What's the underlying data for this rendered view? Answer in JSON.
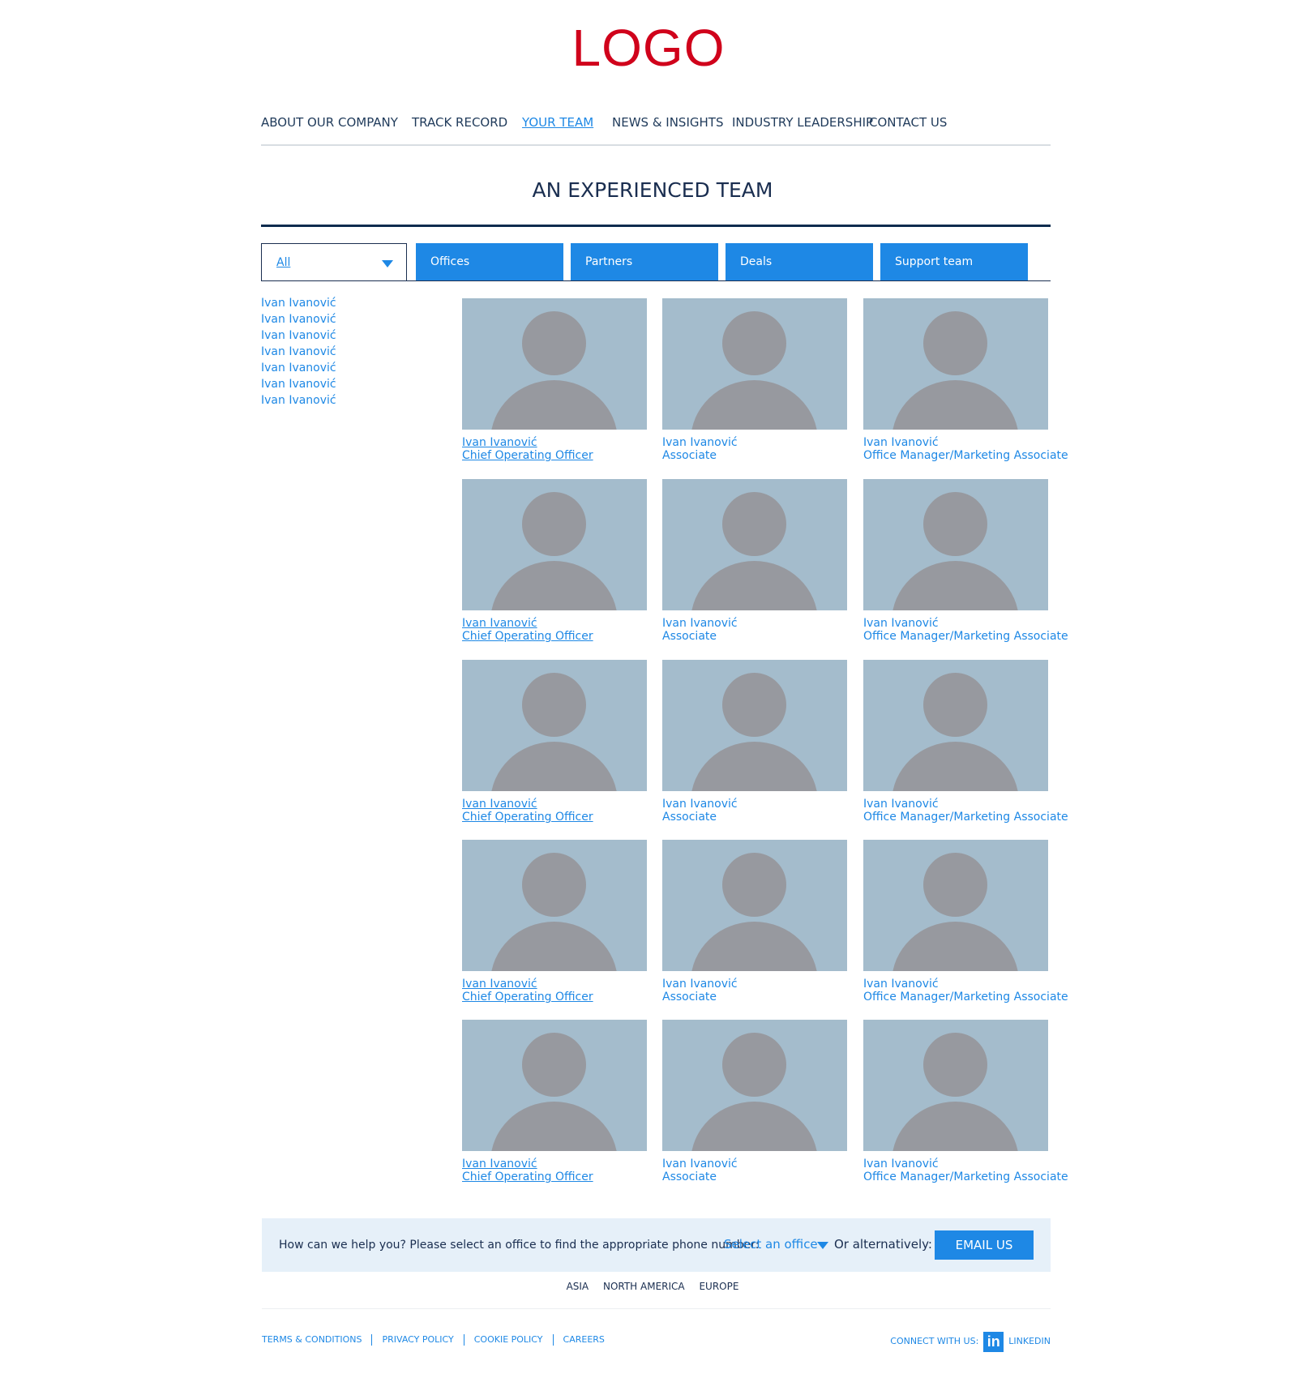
{
  "logo": "LOGO",
  "nav": [
    "ABOUT OUR COMPANY",
    "TRACK RECORD",
    "YOUR TEAM",
    "NEWS & INSIGHTS",
    "INDUSTRY LEADERSHIP",
    "CONTACT US"
  ],
  "nav_active": "YOUR TEAM",
  "page_title": "AN EXPERIENCED TEAM",
  "filter": {
    "dropdown_value": "All",
    "tabs": [
      "Offices",
      "Partners",
      "Deals",
      "Support team"
    ]
  },
  "side_list": [
    "Ivan Ivanović",
    "Ivan Ivanović",
    "Ivan Ivanović",
    "Ivan Ivanović",
    "Ivan Ivanović",
    "Ivan Ivanović",
    "Ivan Ivanović"
  ],
  "team_rows": [
    [
      {
        "name": "Ivan Ivanović",
        "role": "Chief Operating Officer"
      },
      {
        "name": "Ivan Ivanović",
        "role": "Associate"
      },
      {
        "name": "Ivan Ivanović",
        "role": "Office Manager/Marketing Associate"
      }
    ],
    [
      {
        "name": "Ivan Ivanović",
        "role": "Chief Operating Officer"
      },
      {
        "name": "Ivan Ivanović",
        "role": "Associate"
      },
      {
        "name": "Ivan Ivanović",
        "role": "Office Manager/Marketing Associate"
      }
    ],
    [
      {
        "name": "Ivan Ivanović",
        "role": "Chief Operating Officer"
      },
      {
        "name": "Ivan Ivanović",
        "role": "Associate"
      },
      {
        "name": "Ivan Ivanović",
        "role": "Office Manager/Marketing Associate"
      }
    ],
    [
      {
        "name": "Ivan Ivanović",
        "role": "Chief Operating Officer"
      },
      {
        "name": "Ivan Ivanović",
        "role": "Associate"
      },
      {
        "name": "Ivan Ivanović",
        "role": "Office Manager/Marketing Associate"
      }
    ],
    [
      {
        "name": "Ivan Ivanović",
        "role": "Chief Operating Officer"
      },
      {
        "name": "Ivan Ivanović",
        "role": "Associate"
      },
      {
        "name": "Ivan Ivanović",
        "role": "Office Manager/Marketing Associate"
      }
    ]
  ],
  "help": {
    "text": "How can we help you? Please select an office to find the appropriate phone number:",
    "select_placeholder": "Select an office",
    "alternative": "Or alternatively:",
    "email_button": "EMAIL US"
  },
  "regions": [
    "ASIA",
    "NORTH AMERICA",
    "EUROPE"
  ],
  "footer": {
    "links": [
      "TERMS & CONDITIONS",
      "PRIVACY POLICY",
      "COOKIE POLICY",
      "CAREERS"
    ],
    "connect_label": "CONNECT WITH US:",
    "linkedin_icon_text": "in",
    "linkedin_label": "LINKEDIN"
  },
  "colors": {
    "logo": "#d0021b",
    "accent": "#1e88e5",
    "navy": "#1a2e50",
    "photo_bg": "#a4bccc",
    "silhouette": "#97999f",
    "help_bg": "#e6f0f9"
  },
  "icons": {
    "dropdown_caret": "caret-down-icon",
    "avatar": "person-silhouette-icon",
    "social": "linkedin-icon"
  }
}
